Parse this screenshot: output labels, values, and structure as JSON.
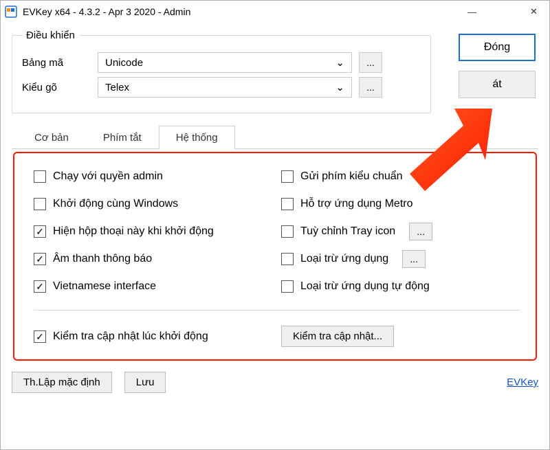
{
  "window": {
    "title": "EVKey x64 - 4.3.2 - Apr  3 2020 - Admin",
    "min": "—",
    "max": "□",
    "close": "✕"
  },
  "control": {
    "legend": "Điều khiển",
    "encoding_label": "Bảng mã",
    "encoding_value": "Unicode",
    "input_label": "Kiểu gõ",
    "input_value": "Telex",
    "dots": "..."
  },
  "sidebtn": {
    "close": "Đóng",
    "exit": "át"
  },
  "tabs": {
    "basic": "Cơ bản",
    "shortcut": "Phím tắt",
    "system": "Hệ thống"
  },
  "options": {
    "left": [
      {
        "label": "Chạy với quyền admin",
        "checked": false
      },
      {
        "label": "Khởi động cùng Windows",
        "checked": false
      },
      {
        "label": "Hiện hộp thoại này khi khởi động",
        "checked": true
      },
      {
        "label": "Âm thanh thông báo",
        "checked": true
      },
      {
        "label": "Vietnamese interface",
        "checked": true
      }
    ],
    "right": [
      {
        "label": "Gửi phím kiểu chuẩn",
        "checked": false,
        "dots": false
      },
      {
        "label": "Hỗ trợ ứng dụng Metro",
        "checked": false,
        "dots": false
      },
      {
        "label": "Tuỳ chỉnh Tray icon",
        "checked": false,
        "dots": true
      },
      {
        "label": "Loại trừ ứng dụng",
        "checked": false,
        "dots": true
      },
      {
        "label": "Loại trừ ứng dụng tự động",
        "checked": false,
        "dots": false
      }
    ],
    "update_check": {
      "label": "Kiểm tra cập nhật lúc khởi động",
      "checked": true
    },
    "update_btn": "Kiểm tra cập nhật...",
    "dots": "..."
  },
  "footer": {
    "defaults": "Th.Lập mặc định",
    "save": "Lưu",
    "link": "EVKey"
  }
}
